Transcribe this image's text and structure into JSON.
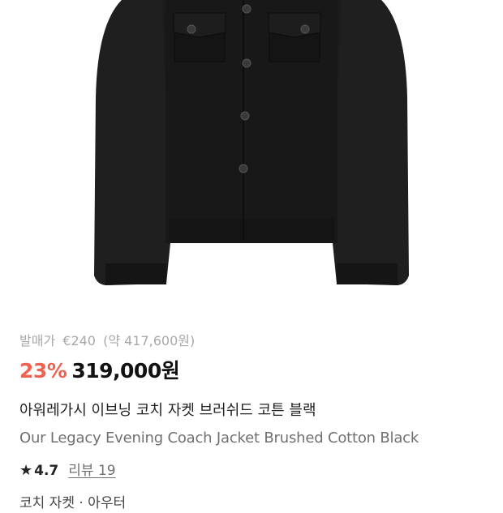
{
  "product": {
    "image_alt": "black jacket",
    "release_label": "발매가",
    "release_price": "€240",
    "release_converted": "(약 417,600원)",
    "discount": "23%",
    "price": "319,000원",
    "name_ko": "아워레가시 이브닝 코치 자켓 브러쉬드 코튼 블랙",
    "name_en": "Our Legacy Evening Coach Jacket Brushed Cotton Black",
    "rating": "4.7",
    "reviews_label": "리뷰 19",
    "category_partial": "코치 자켓 · 아우터"
  },
  "icons": {
    "star": "star-icon"
  },
  "colors": {
    "discount": "#ef6253",
    "price": "#111111",
    "muted": "#a8a8a8",
    "jacket": "#1b1b1b"
  }
}
